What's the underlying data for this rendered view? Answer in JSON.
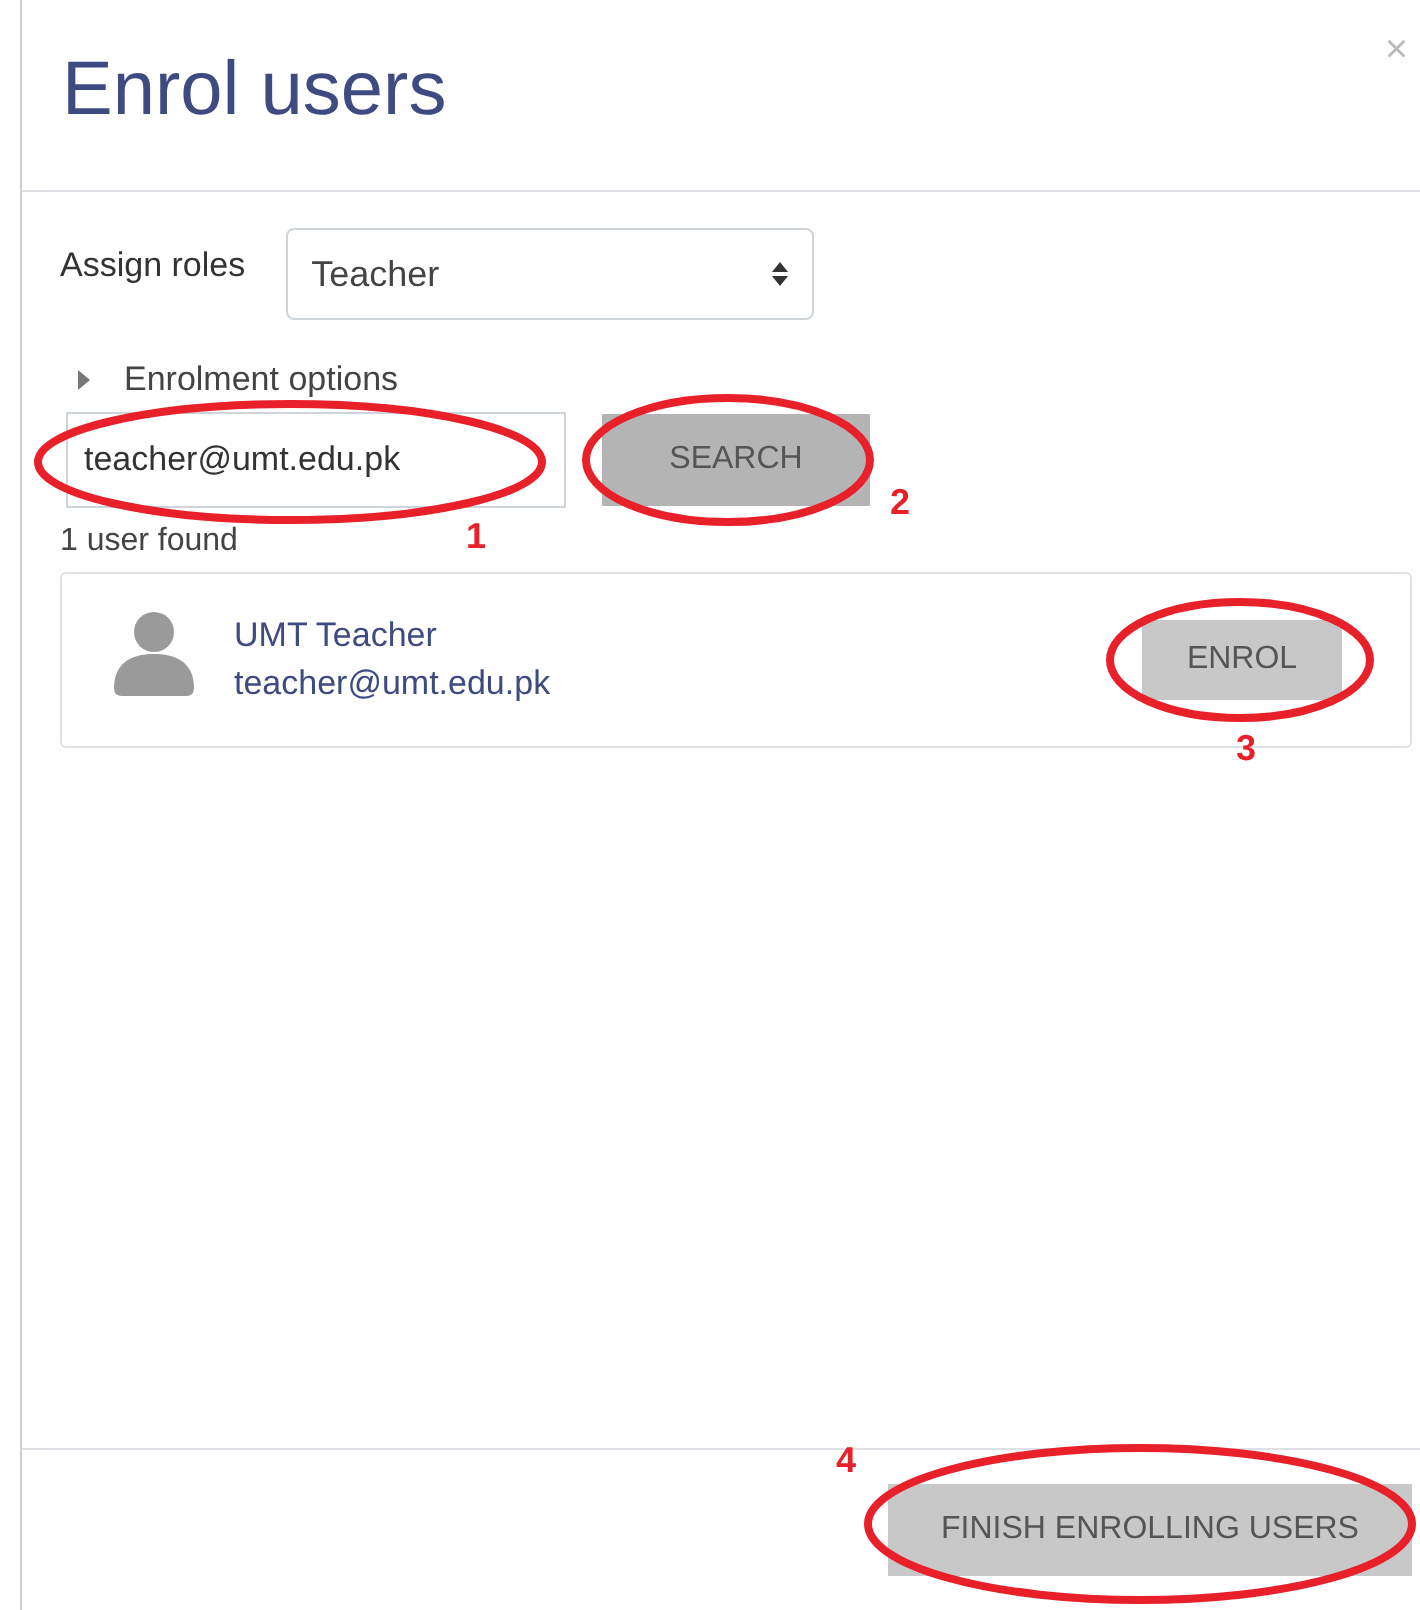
{
  "dialog": {
    "title": "Enrol users",
    "close": "×"
  },
  "assign_roles": {
    "label": "Assign roles",
    "value": "Teacher"
  },
  "enrolment_options": {
    "label": "Enrolment options",
    "expanded": false
  },
  "search": {
    "value": "teacher@umt.edu.pk",
    "button": "SEARCH"
  },
  "result_count": "1 user found",
  "users": [
    {
      "name": "UMT Teacher",
      "email": "teacher@umt.edu.pk",
      "button": "ENROL"
    }
  ],
  "footer": {
    "button": "FINISH ENROLLING USERS"
  },
  "annotations": [
    "1",
    "2",
    "3",
    "4"
  ]
}
